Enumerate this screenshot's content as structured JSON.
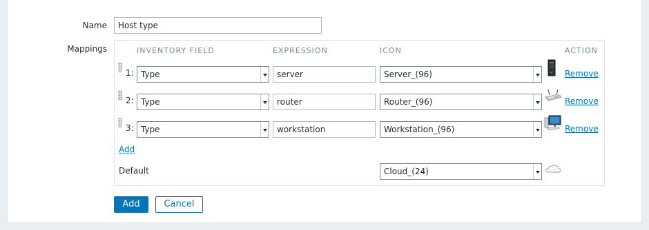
{
  "form": {
    "name_label": "Name",
    "name_value": "Host type",
    "mappings_label": "Mappings"
  },
  "mappings": {
    "headers": {
      "inventory_field": "INVENTORY FIELD",
      "expression": "EXPRESSION",
      "icon": "ICON",
      "action": "ACTION"
    },
    "rows": [
      {
        "num": "1:",
        "field": "Type",
        "expression": "server",
        "icon": "Server_(96)",
        "icon_name": "server-icon",
        "action": "Remove"
      },
      {
        "num": "2:",
        "field": "Type",
        "expression": "router",
        "icon": "Router_(96)",
        "icon_name": "router-icon",
        "action": "Remove"
      },
      {
        "num": "3:",
        "field": "Type",
        "expression": "workstation",
        "icon": "Workstation_(96)",
        "icon_name": "workstation-icon",
        "action": "Remove"
      }
    ],
    "add_link": "Add",
    "default_label": "Default",
    "default_icon": "Cloud_(24)",
    "default_icon_name": "cloud-icon"
  },
  "buttons": {
    "add": "Add",
    "cancel": "Cancel"
  },
  "colors": {
    "accent": "#0275b8",
    "page_bg": "#ebeef0",
    "header_text": "#768d99"
  }
}
